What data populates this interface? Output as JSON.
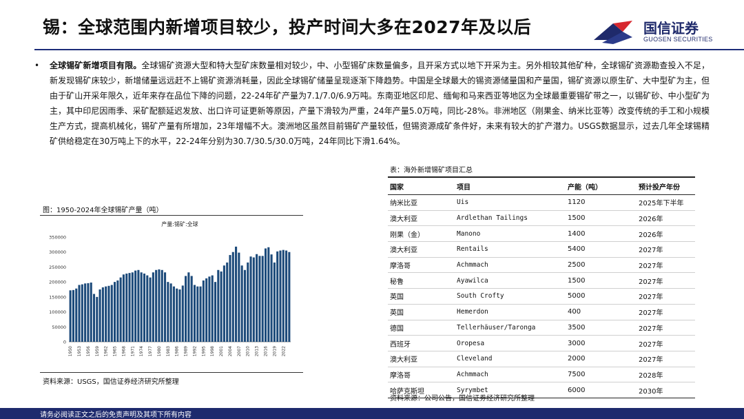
{
  "header": {
    "title": "锡：全球范围内新增项目较少，投产时间大多在2027年及以后",
    "logo_cn": "国信证券",
    "logo_en": "GUOSEN SECURITIES",
    "brand_color": "#1f2a6b",
    "logo_red": "#d7282f"
  },
  "body": {
    "bullet": "•",
    "lead": "全球锡矿新增项目有限。",
    "text": "全球锡矿资源大型和特大型矿床数量相对较少，中、小型锡矿床数量偏多，且开采方式以地下开采为主。另外相较其他矿种，全球锡矿资源勘查投入不足，新发现锡矿床较少，新增储量远远赶不上锡矿资源消耗量，因此全球锡矿储量呈现逐渐下降趋势。中国是全球最大的锡资源储量国和产量国，锡矿资源以原生矿、大中型矿为主，但由于矿山开采年限久，近年来存在品位下降的问题，22-24年矿产量为7.1/7.0/6.9万吨。东南亚地区印尼、缅甸和马来西亚等地区为全球最重要锡矿带之一，以锡矿砂、中小型矿为主，其中印尼因雨季、采矿配额延迟发放、出口许可证更新等原因，产量下滑较为严重，24年产量5.0万吨，同比-28%。非洲地区（刚果金、纳米比亚等）改变传统的手工和小规模生产方式，提高机械化，锡矿产量有所增加，23年增幅不大。澳洲地区虽然目前锡矿产量较低，但锡资源成矿条件好，未来有较大的扩产潜力。USGS数据显示，过去几年全球锡精矿供给稳定在30万吨上下的水平，22-24年分别为30.7/30.5/30.0万吨，24年同比下滑1.64%。"
  },
  "chart_section": {
    "caption": "图：1950-2024年全球锡矿产量（吨）",
    "source": "资料来源：USGS，国信证券经济研究所整理"
  },
  "chart_data": {
    "type": "bar",
    "title": "产量:锡矿:全球",
    "xlabel": "",
    "ylabel": "",
    "ylim": [
      0,
      350000
    ],
    "yticks": [
      "0",
      "50000",
      "100000",
      "150000",
      "200000",
      "250000",
      "300000",
      "350000"
    ],
    "xtick_labels": [
      "1950",
      "1953",
      "1956",
      "1959",
      "1962",
      "1965",
      "1968",
      "1971",
      "1974",
      "1977",
      "1980",
      "1983",
      "1986",
      "1989",
      "1992",
      "1995",
      "1998",
      "2001",
      "2004",
      "2007",
      "2010",
      "2013",
      "2016",
      "2019",
      "2022"
    ],
    "bar_color": "#1c4a7a",
    "grid": false,
    "categories": [
      1950,
      1951,
      1952,
      1953,
      1954,
      1955,
      1956,
      1957,
      1958,
      1959,
      1960,
      1961,
      1962,
      1963,
      1964,
      1965,
      1966,
      1967,
      1968,
      1969,
      1970,
      1971,
      1972,
      1973,
      1974,
      1975,
      1976,
      1977,
      1978,
      1979,
      1980,
      1981,
      1982,
      1983,
      1984,
      1985,
      1986,
      1987,
      1988,
      1989,
      1990,
      1991,
      1992,
      1993,
      1994,
      1995,
      1996,
      1997,
      1998,
      1999,
      2000,
      2001,
      2002,
      2003,
      2004,
      2005,
      2006,
      2007,
      2008,
      2009,
      2010,
      2011,
      2012,
      2013,
      2014,
      2015,
      2016,
      2017,
      2018,
      2019,
      2020,
      2021,
      2022,
      2023,
      2024
    ],
    "values": [
      172000,
      173000,
      178000,
      190000,
      192000,
      195000,
      196000,
      198000,
      160000,
      150000,
      175000,
      182000,
      185000,
      187000,
      190000,
      200000,
      205000,
      215000,
      225000,
      228000,
      230000,
      232000,
      238000,
      240000,
      232000,
      228000,
      222000,
      215000,
      232000,
      240000,
      242000,
      240000,
      232000,
      200000,
      195000,
      185000,
      178000,
      175000,
      188000,
      220000,
      232000,
      220000,
      190000,
      185000,
      185000,
      205000,
      212000,
      218000,
      222000,
      200000,
      240000,
      235000,
      255000,
      265000,
      290000,
      300000,
      318000,
      298000,
      255000,
      240000,
      265000,
      285000,
      282000,
      293000,
      287000,
      287000,
      312000,
      316000,
      292000,
      265000,
      302000,
      305000,
      307000,
      305000,
      300000
    ]
  },
  "table_section": {
    "caption": "表：海外新增锡矿项目汇总",
    "headers": [
      "国家",
      "项目",
      "产能（吨）",
      "预计投产年份"
    ],
    "rows": [
      [
        "纳米比亚",
        "Uis",
        "1120",
        "2025年下半年"
      ],
      [
        "澳大利亚",
        "Ardlethan Tailings",
        "1500",
        "2026年"
      ],
      [
        "刚果（金）",
        "Manono",
        "1400",
        "2026年"
      ],
      [
        "澳大利亚",
        "Rentails",
        "5400",
        "2027年"
      ],
      [
        "摩洛哥",
        "Achmmach",
        "2500",
        "2027年"
      ],
      [
        "秘鲁",
        "Ayawilca",
        "1500",
        "2027年"
      ],
      [
        "英国",
        "South Crofty",
        "5000",
        "2027年"
      ],
      [
        "英国",
        "Hemerdon",
        "400",
        "2027年"
      ],
      [
        "德国",
        "Tellerhäuser/Taronga",
        "3500",
        "2027年"
      ],
      [
        "西班牙",
        "Oropesa",
        "3000",
        "2027年"
      ],
      [
        "澳大利亚",
        "Cleveland",
        "2000",
        "2027年"
      ],
      [
        "摩洛哥",
        "Achmmach",
        "7500",
        "2028年"
      ],
      [
        "哈萨克斯坦",
        "Syrymbet",
        "6000",
        "2030年"
      ]
    ],
    "source": "资料来源：公司公告，国信证券经济研究所整理"
  },
  "footer": {
    "disclaimer": "请务必阅读正文之后的免责声明及其项下所有内容"
  }
}
